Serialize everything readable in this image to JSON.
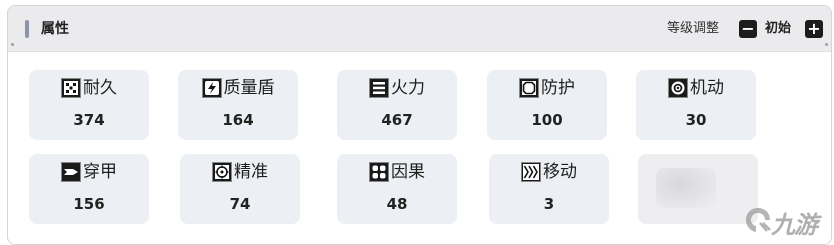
{
  "header": {
    "title": "属性",
    "level_label": "等级调整",
    "minus_label": "−",
    "init_label": "初始",
    "plus_label": "+"
  },
  "stats": [
    {
      "name": "耐久",
      "value": "374",
      "icon": "durability-icon"
    },
    {
      "name": "质量盾",
      "value": "164",
      "icon": "shield-lightning-icon"
    },
    {
      "name": "火力",
      "value": "467",
      "icon": "firepower-icon"
    },
    {
      "name": "防护",
      "value": "100",
      "icon": "armor-icon"
    },
    {
      "name": "机动",
      "value": "30",
      "icon": "mobility-icon"
    },
    {
      "name": "穿甲",
      "value": "156",
      "icon": "penetration-icon"
    },
    {
      "name": "精准",
      "value": "74",
      "icon": "crosshair-icon"
    },
    {
      "name": "因果",
      "value": "48",
      "icon": "causality-icon"
    },
    {
      "name": "移动",
      "value": "3",
      "icon": "movement-icon"
    }
  ],
  "watermark": {
    "text": "九游",
    "icon": "jiuyou-logo-icon"
  },
  "colors": {
    "card_bg": "#eceff3",
    "header_bg": "#ebebee",
    "accent_bar": "#8d93a8"
  }
}
